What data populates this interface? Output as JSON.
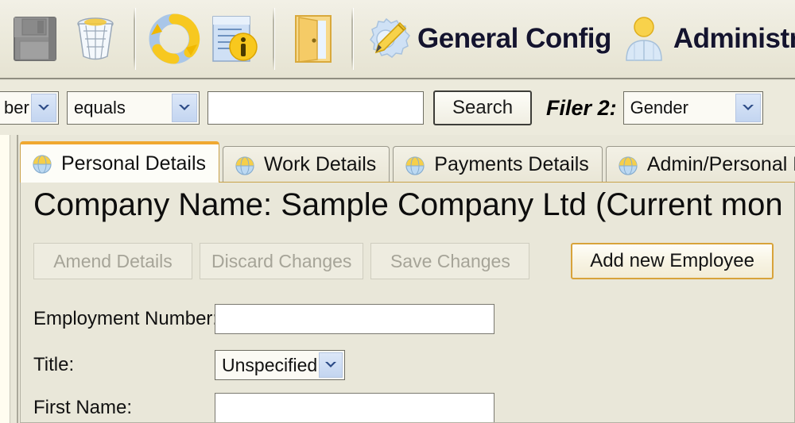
{
  "app": {
    "background_color": "#e9e7d9",
    "accent_color": "#f0a830"
  },
  "toolbar": {
    "buttons": [
      {
        "name": "save-button",
        "icon": "floppy-disk-icon",
        "label": "",
        "enabled": false
      },
      {
        "name": "delete-button",
        "icon": "trash-bin-icon",
        "label": "",
        "enabled": true
      },
      {
        "name": "refresh-button",
        "icon": "refresh-circle-icon",
        "label": "",
        "enabled": true
      },
      {
        "name": "report-info-button",
        "icon": "document-info-icon",
        "label": "",
        "enabled": true
      },
      {
        "name": "exit-button",
        "icon": "exit-door-icon",
        "label": "",
        "enabled": true
      }
    ],
    "general_config_label": "General Config",
    "general_config_icon": "pencil-gear-icon",
    "administration_label": "Administra",
    "administration_icon": "user-person-icon"
  },
  "filterbar": {
    "field_select_value": "ber",
    "operator_select_value": "equals",
    "value_input": "",
    "value_placeholder": "",
    "search_button_label": "Search",
    "filer2_label": "Filer 2:",
    "filer2_select_value": "Gender"
  },
  "tabs": [
    {
      "label": "Personal Details",
      "icon": "globe-icon",
      "active": true
    },
    {
      "label": "Work Details",
      "icon": "globe-icon",
      "active": false
    },
    {
      "label": "Payments Details",
      "icon": "globe-icon",
      "active": false
    },
    {
      "label": "Admin/Personal Notes",
      "icon": "globe-icon",
      "active": false
    }
  ],
  "panel": {
    "company_heading": "Company Name: Sample Company Ltd  (Current mon",
    "actions": {
      "amend_label": "Amend Details",
      "discard_label": "Discard Changes",
      "save_label": "Save Changes",
      "add_employee_label": "Add new Employee"
    },
    "form": {
      "employment_number_label": "Employment Number:",
      "employment_number_value": "",
      "title_label": "Title:",
      "title_value": "Unspecified",
      "first_name_label": "First Name:",
      "first_name_value": ""
    }
  }
}
